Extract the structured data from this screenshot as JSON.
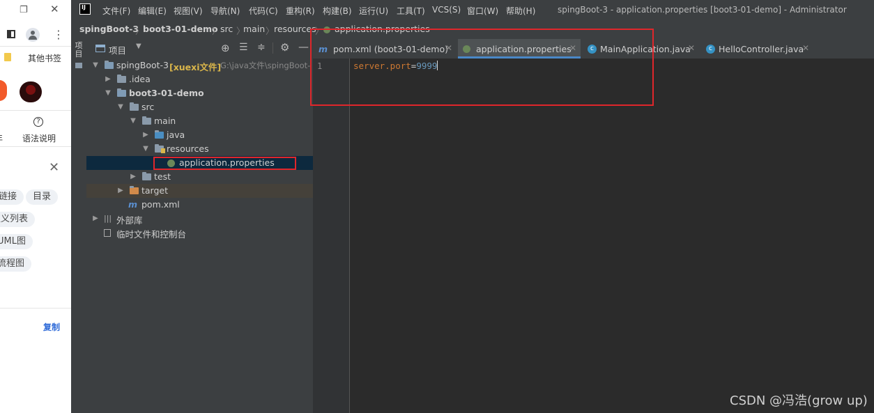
{
  "browser": {
    "bookmark": "其他书签",
    "help_label": "语法说明",
    "chips": [
      "链接",
      "目录",
      "定义列表",
      "UML图",
      "流程图"
    ],
    "copy": "复制"
  },
  "ide": {
    "logo": "IJ",
    "menu": [
      "文件(F)",
      "编辑(E)",
      "视图(V)",
      "导航(N)",
      "代码(C)",
      "重构(R)",
      "构建(B)",
      "运行(U)",
      "工具(T)",
      "VCS(S)",
      "窗口(W)",
      "帮助(H)"
    ],
    "window_title": "spingBoot-3 - application.properties [boot3-01-demo] - Administrator",
    "breadcrumb": [
      "spingBoot-3",
      "boot3-01-demo",
      "src",
      "main",
      "resources",
      "application.properties"
    ],
    "stripe_label": "项目",
    "project_header": "项目",
    "tree": [
      {
        "label": "spingBoot-3",
        "extra": "[xuexi文件]",
        "path": "G:\\java文件\\spingBoot-"
      },
      {
        "label": ".idea"
      },
      {
        "label": "boot3-01-demo"
      },
      {
        "label": "src"
      },
      {
        "label": "main"
      },
      {
        "label": "java"
      },
      {
        "label": "resources"
      },
      {
        "label": "application.properties"
      },
      {
        "label": "test"
      },
      {
        "label": "target"
      },
      {
        "label": "pom.xml"
      },
      {
        "label": "外部库"
      },
      {
        "label": "临时文件和控制台"
      }
    ],
    "tabs": [
      {
        "label": "pom.xml (boot3-01-demo)",
        "icon": "m"
      },
      {
        "label": "application.properties",
        "icon": "spring"
      },
      {
        "label": "MainApplication.java",
        "icon": "c"
      },
      {
        "label": "HelloController.java",
        "icon": "c"
      }
    ],
    "editor": {
      "line_number": "1",
      "key": "server.port",
      "eq": "=",
      "value": "9999"
    }
  },
  "watermark": "CSDN @冯浩(grow up)",
  "colors": {
    "highlight_box": "#e0262b",
    "key_color": "#cc7832",
    "value_color": "#6897bb"
  }
}
